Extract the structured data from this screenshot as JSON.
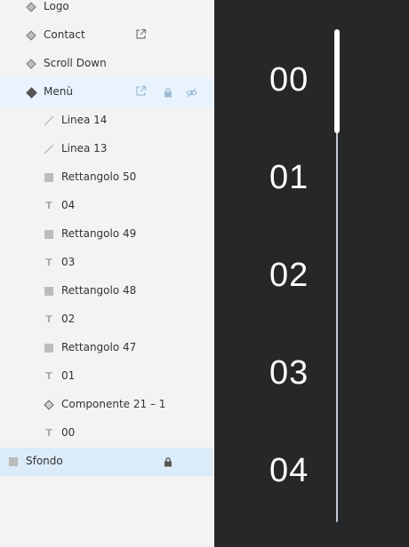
{
  "layers": [
    {
      "label": "Logo",
      "icon": "diamond-outline-icon"
    },
    {
      "label": "Contact",
      "icon": "diamond-outline-icon",
      "actions": [
        "external-link-icon"
      ]
    },
    {
      "label": "Scroll Down",
      "icon": "diamond-outline-icon"
    },
    {
      "label": "Menù",
      "icon": "diamond-filled-icon",
      "actions": [
        "external-link-icon",
        "lock-icon",
        "eye-off-icon"
      ],
      "selected": true
    },
    {
      "label": "Linea 14",
      "icon": "line-icon"
    },
    {
      "label": "Linea 13",
      "icon": "line-icon"
    },
    {
      "label": "Rettangolo 50",
      "icon": "rectangle-icon"
    },
    {
      "label": "04",
      "icon": "text-icon"
    },
    {
      "label": "Rettangolo 49",
      "icon": "rectangle-icon"
    },
    {
      "label": "03",
      "icon": "text-icon"
    },
    {
      "label": "Rettangolo 48",
      "icon": "rectangle-icon"
    },
    {
      "label": "02",
      "icon": "text-icon"
    },
    {
      "label": "Rettangolo 47",
      "icon": "rectangle-icon"
    },
    {
      "label": "01",
      "icon": "text-icon"
    },
    {
      "label": "Componente 21 – 1",
      "icon": "component-icon"
    },
    {
      "label": "00",
      "icon": "text-icon"
    },
    {
      "label": "Sfondo",
      "icon": "rectangle-icon",
      "actions": [
        "lock-icon"
      ],
      "selected": true
    }
  ],
  "text_glyph": "T",
  "preview": {
    "numbers": [
      "00",
      "01",
      "02",
      "03",
      "04"
    ],
    "scroll_fraction": 0.2
  },
  "colors": {
    "panel_bg": "#f3f3f3",
    "selected_row": "#e9f3fd",
    "selected_row_strong": "#dcebf8",
    "artboard_bg": "#262729",
    "number_color": "#ffffff",
    "track": "#bfc9d2"
  }
}
